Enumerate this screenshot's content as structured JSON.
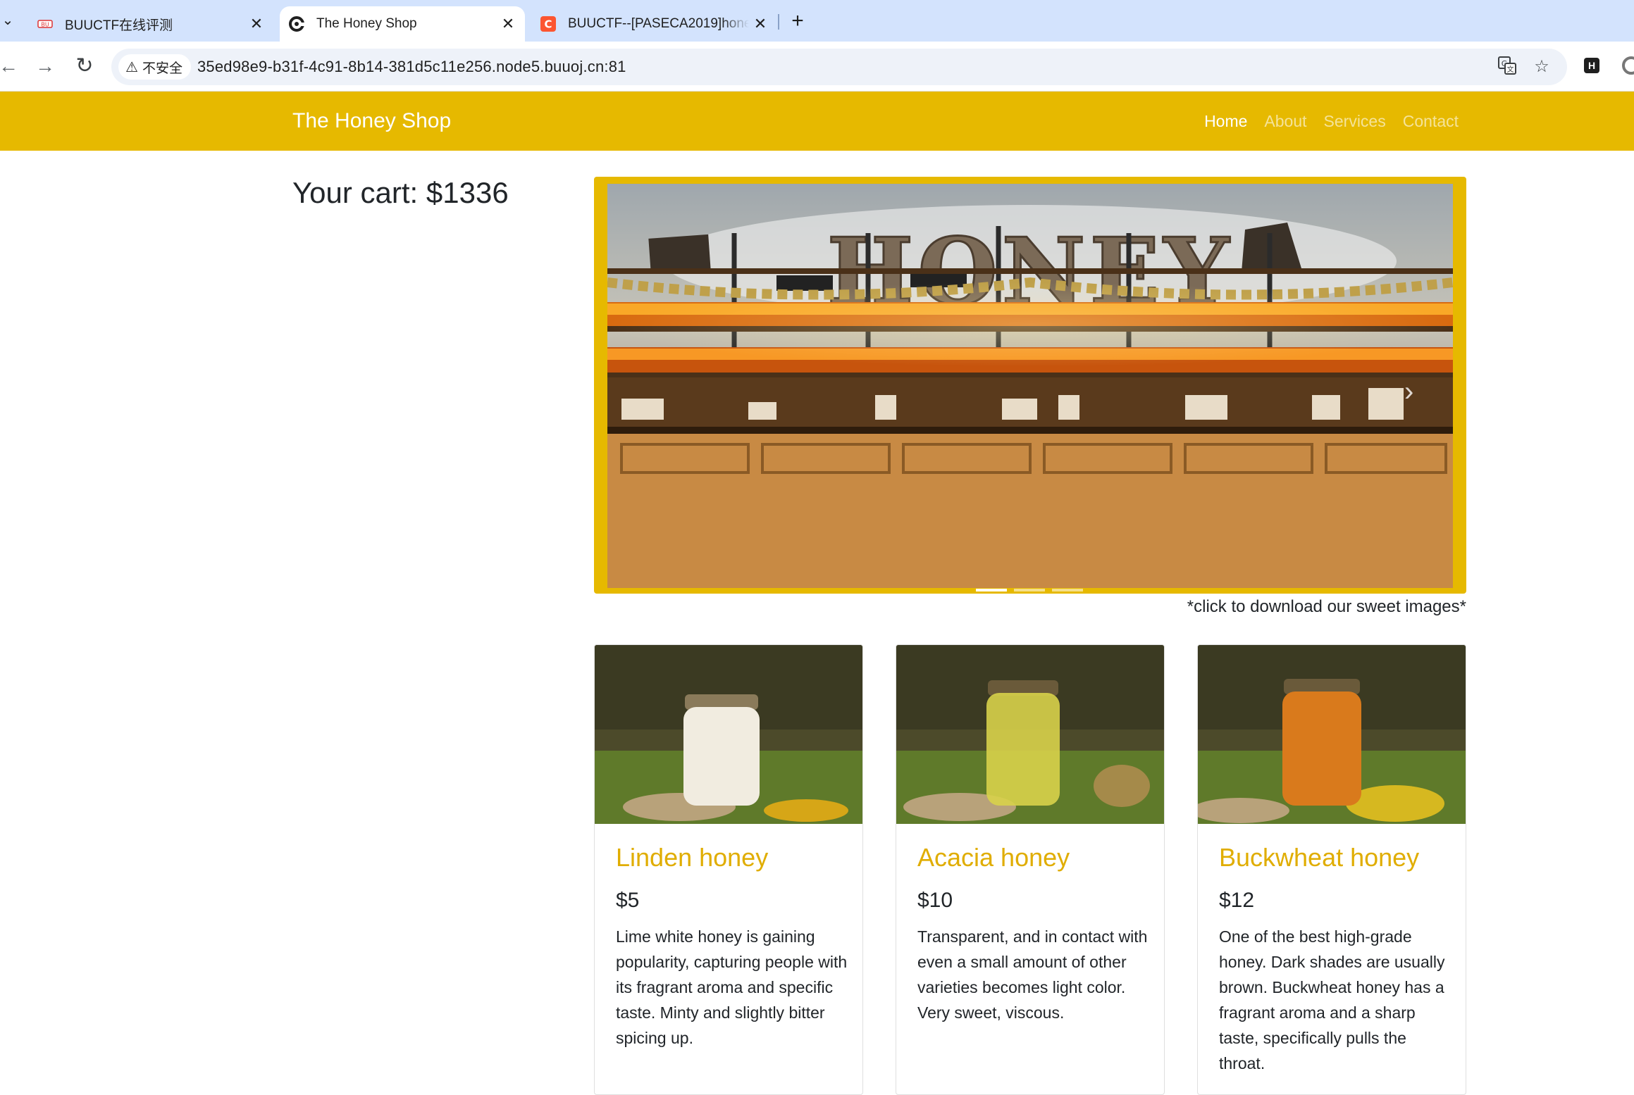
{
  "browser": {
    "tabs": [
      {
        "title": "BUUCTF在线评测",
        "icon": "buuctf-favicon",
        "active": false
      },
      {
        "title": "The Honey Shop",
        "icon": "honey-shop-favicon",
        "active": true
      },
      {
        "title": "BUUCTF--[PASECA2019]hone",
        "icon": "csdn-favicon",
        "active": false
      }
    ],
    "security_label": "不安全",
    "url": "35ed98e9-b31f-4c91-8b14-381d5c11e256.node5.buuoj.cn:81",
    "extension_label": "H"
  },
  "site": {
    "brand": "The Honey Shop",
    "nav": [
      "Home",
      "About",
      "Services",
      "Contact"
    ],
    "active_nav": "Home",
    "accent_color": "#e6b900"
  },
  "cart": {
    "text": "Your cart: $1336"
  },
  "carousel": {
    "slide_count": 3,
    "active_slide": 1,
    "sign_text": "HONEY",
    "caption": "*click to download our sweet images*"
  },
  "products": [
    {
      "name": "Linden honey",
      "price": "$5",
      "description": "Lime white honey is gaining popularity, capturing people with its fragrant aroma and specific taste. Minty and slightly bitter spicing up.",
      "jar_color": "#f1ece0"
    },
    {
      "name": "Acacia honey",
      "price": "$10",
      "description": "Transparent, and in contact with even a small amount of other varieties becomes light color. Very sweet, viscous.",
      "jar_color": "#d8d24a"
    },
    {
      "name": "Buckwheat honey",
      "price": "$12",
      "description": "One of the best high-grade honey. Dark shades are usually brown. Buckwheat honey has a fragrant aroma and a sharp taste, specifically pulls the throat.",
      "jar_color": "#d97a1c"
    }
  ]
}
